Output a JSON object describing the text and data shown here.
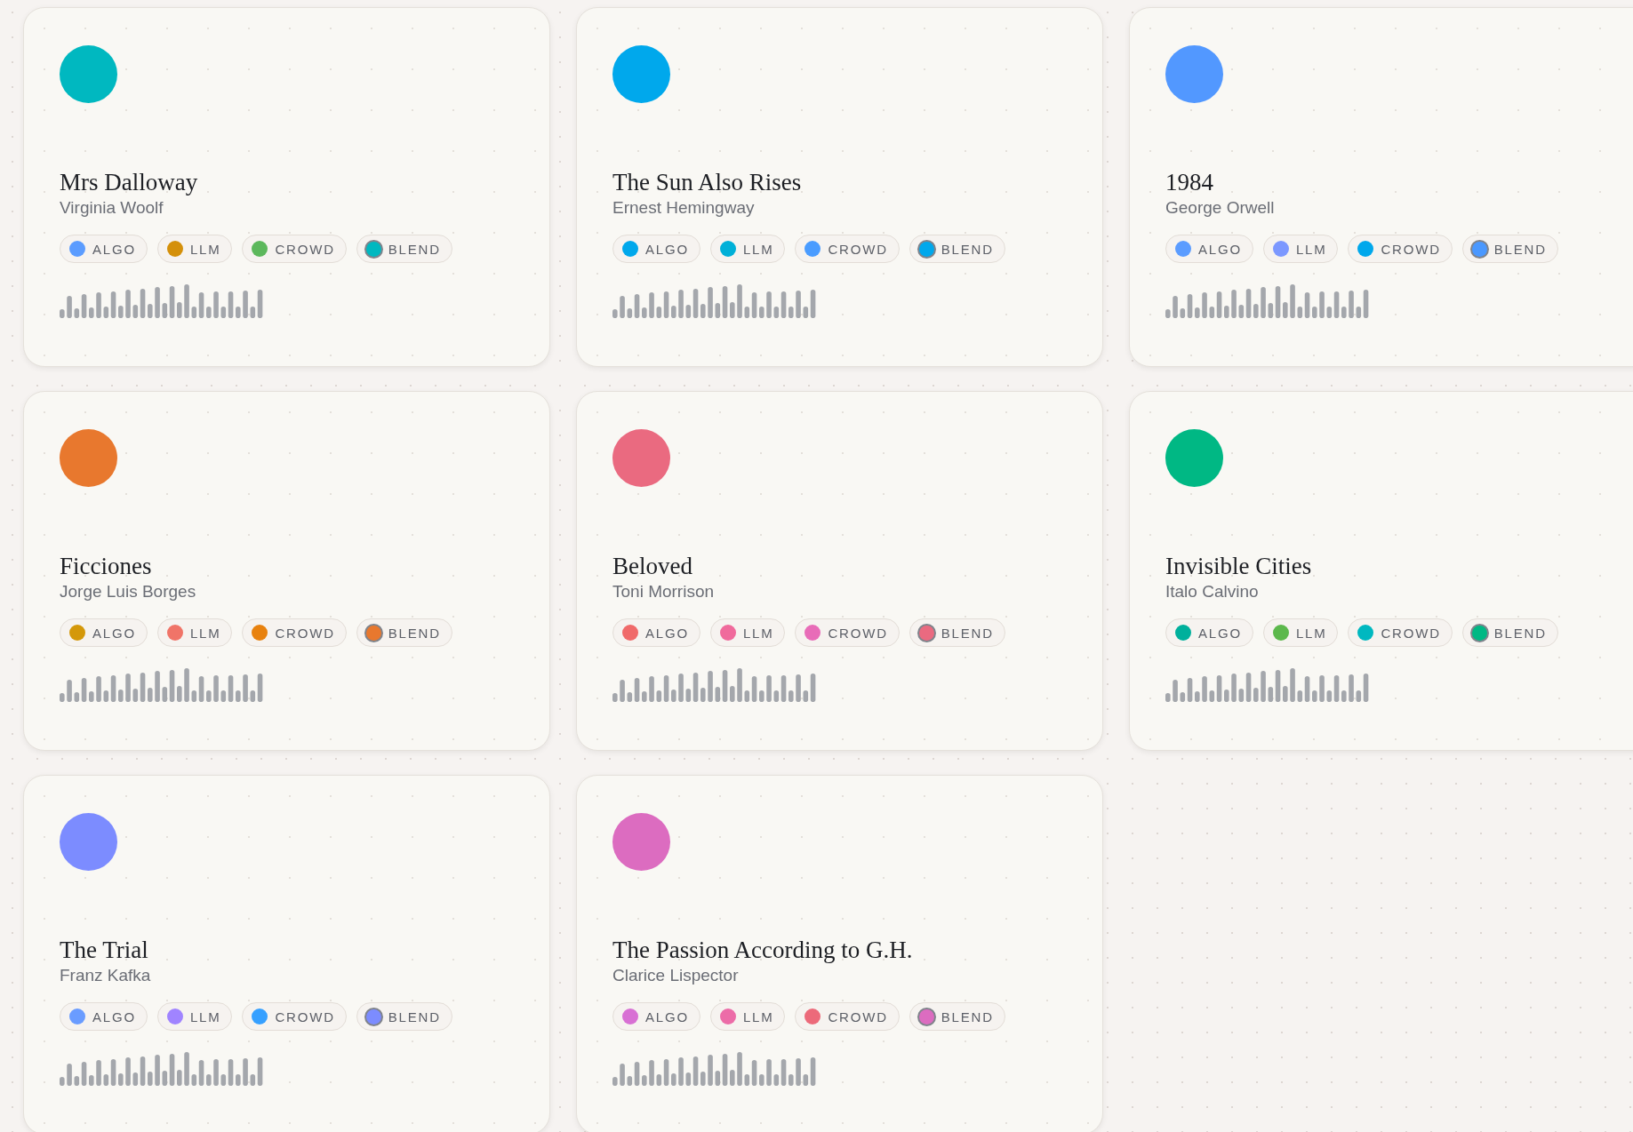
{
  "cards": [
    {
      "title": "Mrs Dalloway",
      "author": "Virginia Woolf",
      "color": "#00b8c0",
      "tags": [
        {
          "label": "ALGO",
          "kind": "source",
          "color": "#5b9cff"
        },
        {
          "label": "LLM",
          "kind": "source",
          "color": "#d4900a"
        },
        {
          "label": "CROWD",
          "kind": "source",
          "color": "#5cb85c"
        },
        {
          "label": "BLEND",
          "kind": "blend",
          "color": "#00b8c0"
        }
      ]
    },
    {
      "title": "The Sun Also Rises",
      "author": "Ernest Hemingway",
      "color": "#00a8ec",
      "tags": [
        {
          "label": "ALGO",
          "kind": "source",
          "color": "#00a8ec"
        },
        {
          "label": "LLM",
          "kind": "source",
          "color": "#00b0d8"
        },
        {
          "label": "CROWD",
          "kind": "source",
          "color": "#4a9cff"
        },
        {
          "label": "BLEND",
          "kind": "blend",
          "color": "#00a8ec"
        }
      ]
    },
    {
      "title": "1984",
      "author": "George Orwell",
      "color": "#5298ff",
      "tags": [
        {
          "label": "ALGO",
          "kind": "source",
          "color": "#5b9cff"
        },
        {
          "label": "LLM",
          "kind": "source",
          "color": "#7c98ff"
        },
        {
          "label": "CROWD",
          "kind": "source",
          "color": "#00a8ec"
        },
        {
          "label": "BLEND",
          "kind": "blend",
          "color": "#4a98ff"
        }
      ]
    },
    {
      "title": "Ficciones",
      "author": "Jorge Luis Borges",
      "color": "#e8782e",
      "tags": [
        {
          "label": "ALGO",
          "kind": "source",
          "color": "#d4980a"
        },
        {
          "label": "LLM",
          "kind": "source",
          "color": "#f07468"
        },
        {
          "label": "CROWD",
          "kind": "source",
          "color": "#e8820f"
        },
        {
          "label": "BLEND",
          "kind": "blend",
          "color": "#e8782e"
        }
      ]
    },
    {
      "title": "Beloved",
      "author": "Toni Morrison",
      "color": "#ea6a80",
      "tags": [
        {
          "label": "ALGO",
          "kind": "source",
          "color": "#f06a6a"
        },
        {
          "label": "LLM",
          "kind": "source",
          "color": "#f06a9c"
        },
        {
          "label": "CROWD",
          "kind": "source",
          "color": "#e86cb8"
        },
        {
          "label": "BLEND",
          "kind": "blend",
          "color": "#ea6a80"
        }
      ]
    },
    {
      "title": "Invisible Cities",
      "author": "Italo Calvino",
      "color": "#00b884",
      "tags": [
        {
          "label": "ALGO",
          "kind": "source",
          "color": "#00b09c"
        },
        {
          "label": "LLM",
          "kind": "source",
          "color": "#5cb84c"
        },
        {
          "label": "CROWD",
          "kind": "source",
          "color": "#00b8c0"
        },
        {
          "label": "BLEND",
          "kind": "blend",
          "color": "#00b884"
        }
      ]
    },
    {
      "title": "The Trial",
      "author": "Franz Kafka",
      "color": "#7c8cff",
      "tags": [
        {
          "label": "ALGO",
          "kind": "source",
          "color": "#6a9cff"
        },
        {
          "label": "LLM",
          "kind": "source",
          "color": "#a084ff"
        },
        {
          "label": "CROWD",
          "kind": "source",
          "color": "#36a0ff"
        },
        {
          "label": "BLEND",
          "kind": "blend",
          "color": "#7c8cff"
        }
      ]
    },
    {
      "title": "The Passion According to G.H.",
      "author": "Clarice Lispector",
      "color": "#dc6cc0",
      "tags": [
        {
          "label": "ALGO",
          "kind": "source",
          "color": "#d870d4"
        },
        {
          "label": "LLM",
          "kind": "source",
          "color": "#ec6ca8"
        },
        {
          "label": "CROWD",
          "kind": "source",
          "color": "#ec6a7a"
        },
        {
          "label": "BLEND",
          "kind": "blend",
          "color": "#dc6cc0"
        }
      ]
    }
  ]
}
